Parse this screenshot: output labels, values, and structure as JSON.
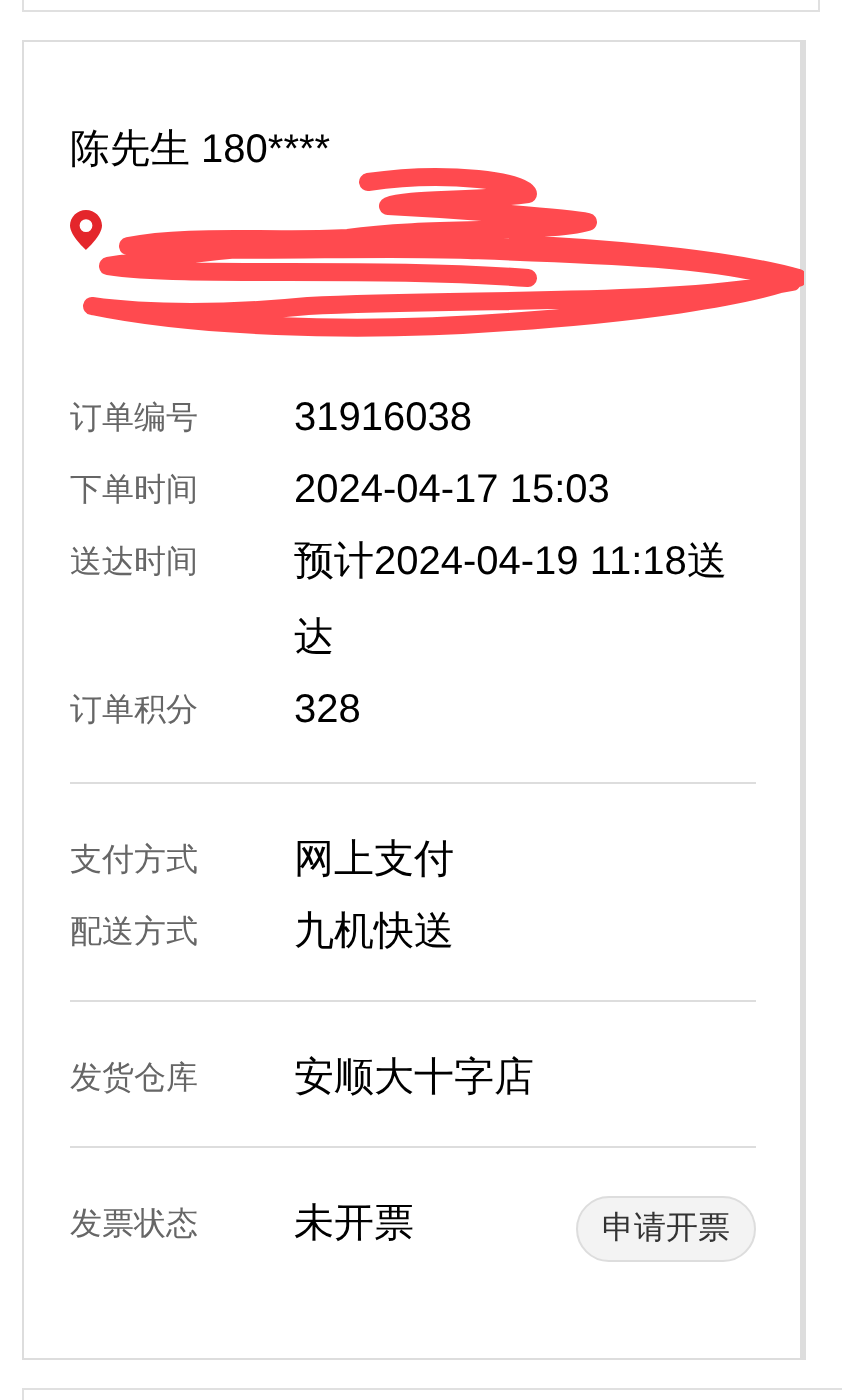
{
  "contact": {
    "name_phone": "陈先生 180****"
  },
  "sections": [
    {
      "rows": [
        {
          "label": "订单编号",
          "value": "31916038"
        },
        {
          "label": "下单时间",
          "value": "2024-04-17 15:03"
        },
        {
          "label": "送达时间",
          "value": "预计2024-04-19 11:18送达"
        },
        {
          "label": "订单积分",
          "value": "328"
        }
      ]
    },
    {
      "rows": [
        {
          "label": "支付方式",
          "value": "网上支付"
        },
        {
          "label": "配送方式",
          "value": "九机快送"
        }
      ]
    },
    {
      "rows": [
        {
          "label": "发货仓库",
          "value": "安顺大十字店"
        }
      ]
    },
    {
      "rows": [
        {
          "label": "发票状态",
          "value": "未开票",
          "action": "申请开票"
        }
      ]
    }
  ]
}
